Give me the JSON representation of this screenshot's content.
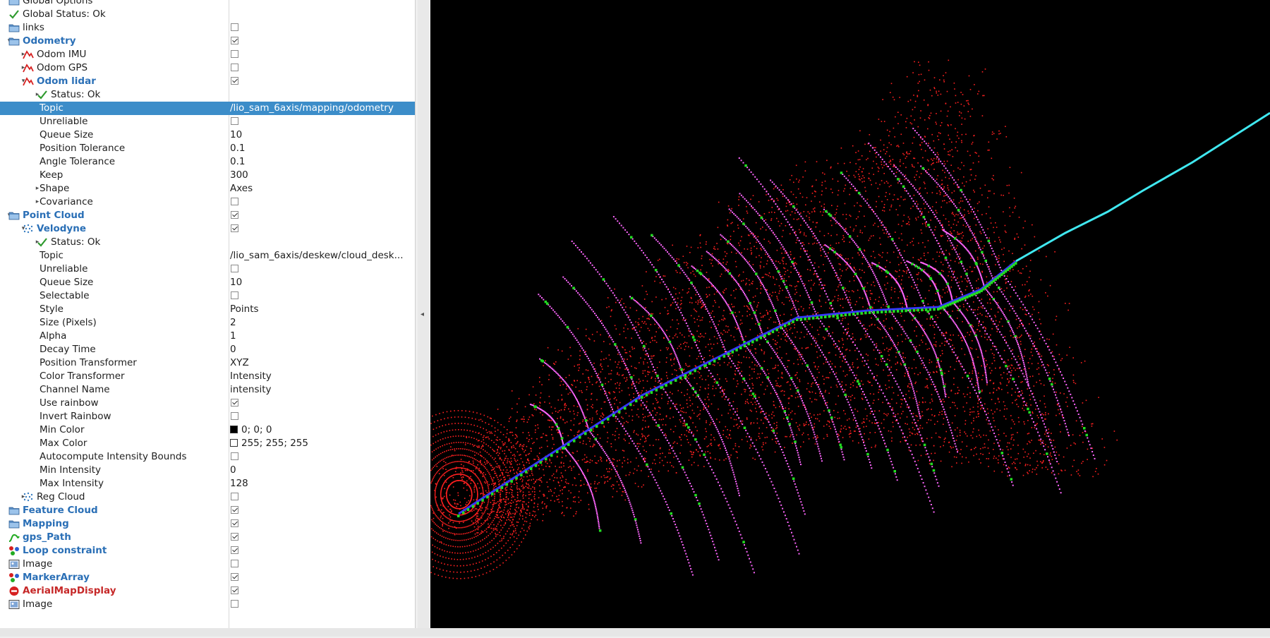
{
  "panel": {
    "rows": [
      {
        "depth": 0,
        "expand": "",
        "icon": "folder-icon",
        "label": "Global Options",
        "style": ""
      },
      {
        "depth": 0,
        "expand": "",
        "icon": "check-icon",
        "label": "Global Status: Ok",
        "style": ""
      },
      {
        "depth": 0,
        "expand": "",
        "icon": "folder-icon",
        "label": "links",
        "style": "",
        "checkbox": false
      },
      {
        "depth": 0,
        "expand": "down",
        "icon": "folder-icon",
        "label": "Odometry",
        "style": "bold",
        "checkbox": true
      },
      {
        "depth": 1,
        "expand": "right",
        "icon": "odometry-icon",
        "label": "Odom IMU",
        "style": "",
        "checkbox": false
      },
      {
        "depth": 1,
        "expand": "right",
        "icon": "odometry-icon",
        "label": "Odom GPS",
        "style": "",
        "checkbox": false
      },
      {
        "depth": 1,
        "expand": "down",
        "icon": "odometry-icon",
        "label": "Odom lidar",
        "style": "bold",
        "checkbox": true
      },
      {
        "depth": 2,
        "expand": "right",
        "icon": "check-icon",
        "label": "Status: Ok",
        "style": ""
      },
      {
        "depth": 2,
        "expand": "",
        "icon": "",
        "label": "Topic",
        "style": "",
        "value": "/lio_sam_6axis/mapping/odometry",
        "selected": true
      },
      {
        "depth": 2,
        "expand": "",
        "icon": "",
        "label": "Unreliable",
        "style": "",
        "checkbox": false
      },
      {
        "depth": 2,
        "expand": "",
        "icon": "",
        "label": "Queue Size",
        "style": "",
        "value": "10"
      },
      {
        "depth": 2,
        "expand": "",
        "icon": "",
        "label": "Position Tolerance",
        "style": "",
        "value": "0.1"
      },
      {
        "depth": 2,
        "expand": "",
        "icon": "",
        "label": "Angle Tolerance",
        "style": "",
        "value": "0.1"
      },
      {
        "depth": 2,
        "expand": "",
        "icon": "",
        "label": "Keep",
        "style": "",
        "value": "300"
      },
      {
        "depth": 2,
        "expand": "right",
        "icon": "",
        "label": "Shape",
        "style": "",
        "value": "Axes"
      },
      {
        "depth": 2,
        "expand": "right",
        "icon": "",
        "label": "Covariance",
        "style": "",
        "checkbox": false
      },
      {
        "depth": 0,
        "expand": "down",
        "icon": "folder-icon",
        "label": "Point Cloud",
        "style": "bold",
        "checkbox": true
      },
      {
        "depth": 1,
        "expand": "down",
        "icon": "point-cloud-icon",
        "label": "Velodyne",
        "style": "bold",
        "checkbox": true
      },
      {
        "depth": 2,
        "expand": "right",
        "icon": "check-icon",
        "label": "Status: Ok",
        "style": ""
      },
      {
        "depth": 2,
        "expand": "",
        "icon": "",
        "label": "Topic",
        "style": "",
        "value": "/lio_sam_6axis/deskew/cloud_desk..."
      },
      {
        "depth": 2,
        "expand": "",
        "icon": "",
        "label": "Unreliable",
        "style": "",
        "checkbox": false
      },
      {
        "depth": 2,
        "expand": "",
        "icon": "",
        "label": "Queue Size",
        "style": "",
        "value": "10"
      },
      {
        "depth": 2,
        "expand": "",
        "icon": "",
        "label": "Selectable",
        "style": "",
        "checkbox": false
      },
      {
        "depth": 2,
        "expand": "",
        "icon": "",
        "label": "Style",
        "style": "",
        "value": "Points"
      },
      {
        "depth": 2,
        "expand": "",
        "icon": "",
        "label": "Size (Pixels)",
        "style": "",
        "value": "2"
      },
      {
        "depth": 2,
        "expand": "",
        "icon": "",
        "label": "Alpha",
        "style": "",
        "value": "1"
      },
      {
        "depth": 2,
        "expand": "",
        "icon": "",
        "label": "Decay Time",
        "style": "",
        "value": "0"
      },
      {
        "depth": 2,
        "expand": "",
        "icon": "",
        "label": "Position Transformer",
        "style": "",
        "value": "XYZ"
      },
      {
        "depth": 2,
        "expand": "",
        "icon": "",
        "label": "Color Transformer",
        "style": "",
        "value": "Intensity"
      },
      {
        "depth": 2,
        "expand": "",
        "icon": "",
        "label": "Channel Name",
        "style": "",
        "value": "intensity"
      },
      {
        "depth": 2,
        "expand": "",
        "icon": "",
        "label": "Use rainbow",
        "style": "",
        "checkbox": true
      },
      {
        "depth": 2,
        "expand": "",
        "icon": "",
        "label": "Invert Rainbow",
        "style": "",
        "checkbox": false
      },
      {
        "depth": 2,
        "expand": "",
        "icon": "",
        "label": "Min Color",
        "style": "",
        "value": "0; 0; 0",
        "swatch": "#000000"
      },
      {
        "depth": 2,
        "expand": "",
        "icon": "",
        "label": "Max Color",
        "style": "",
        "value": "255; 255; 255",
        "swatch": "#ffffff"
      },
      {
        "depth": 2,
        "expand": "",
        "icon": "",
        "label": "Autocompute Intensity Bounds",
        "style": "",
        "checkbox": false
      },
      {
        "depth": 2,
        "expand": "",
        "icon": "",
        "label": "Min Intensity",
        "style": "",
        "value": "0"
      },
      {
        "depth": 2,
        "expand": "",
        "icon": "",
        "label": "Max Intensity",
        "style": "",
        "value": "128"
      },
      {
        "depth": 1,
        "expand": "right",
        "icon": "point-cloud-icon",
        "label": "Reg Cloud",
        "style": "",
        "checkbox": false
      },
      {
        "depth": 0,
        "expand": "",
        "icon": "folder-icon",
        "label": "Feature Cloud",
        "style": "bold",
        "checkbox": true
      },
      {
        "depth": 0,
        "expand": "",
        "icon": "folder-icon",
        "label": "Mapping",
        "style": "bold",
        "checkbox": true
      },
      {
        "depth": 0,
        "expand": "",
        "icon": "path-icon",
        "label": "gps_Path",
        "style": "bold",
        "checkbox": true
      },
      {
        "depth": 0,
        "expand": "",
        "icon": "marker-icon",
        "label": "Loop constraint",
        "style": "bold",
        "checkbox": true
      },
      {
        "depth": 0,
        "expand": "",
        "icon": "image-icon",
        "label": "Image",
        "style": "",
        "checkbox": false
      },
      {
        "depth": 0,
        "expand": "",
        "icon": "marker-icon",
        "label": "MarkerArray",
        "style": "bold",
        "checkbox": true
      },
      {
        "depth": 0,
        "expand": "",
        "icon": "error-icon",
        "label": "AerialMapDisplay",
        "style": "err",
        "checkbox": true
      },
      {
        "depth": 0,
        "expand": "",
        "icon": "image-icon",
        "label": "Image",
        "style": "",
        "checkbox": false
      }
    ]
  },
  "viewport": {
    "background": "#000000",
    "cloud_color": "#ff2020",
    "scan_color": "#ff66ff",
    "feature_color": "#22dd22",
    "path_color": "#3535ff",
    "trajectory_color": "#40e8f0"
  }
}
